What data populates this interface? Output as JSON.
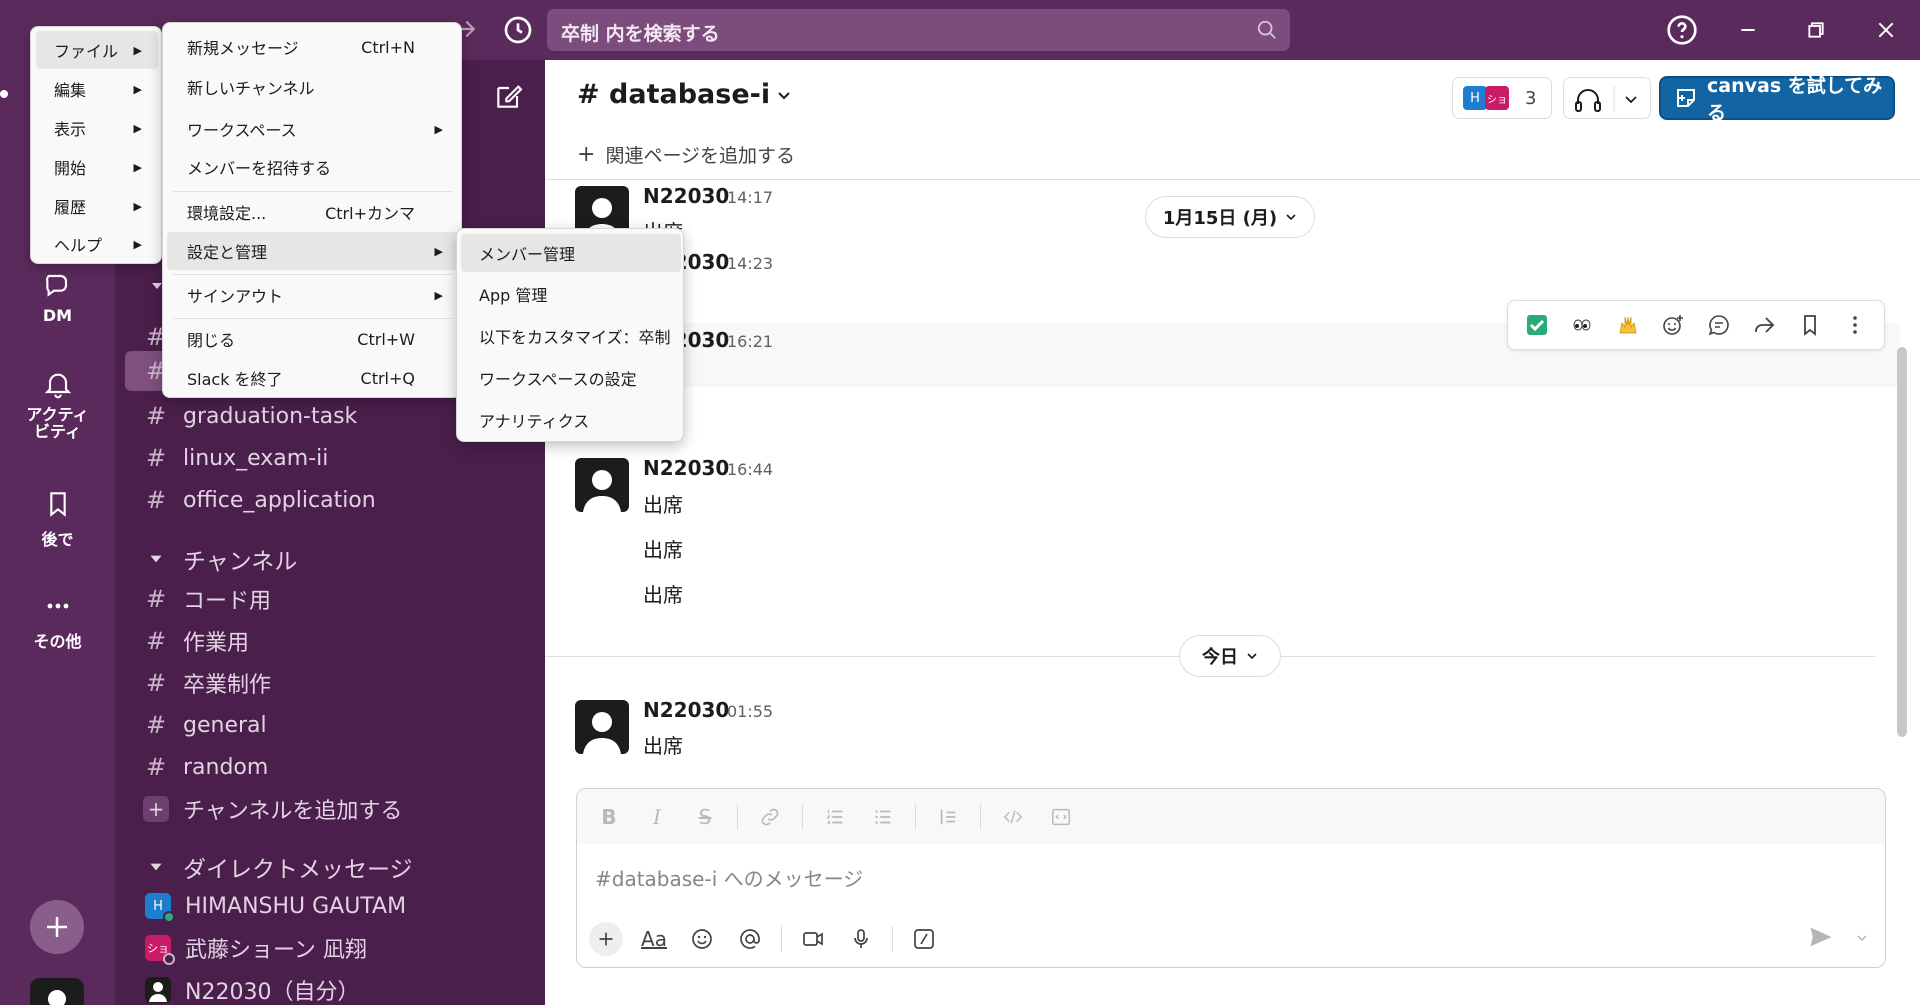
{
  "search": {
    "placeholder": "卒制 内を検索する"
  },
  "rail": {
    "dm_label": "DM",
    "activity_label": "アクティ\nビティ",
    "later_label": "後で",
    "more_label": "その他"
  },
  "sidebar": {
    "channels_partial": [
      {
        "name": "graduation-task"
      },
      {
        "name": "linux_exam-ii"
      },
      {
        "name": "office_application"
      }
    ],
    "channels_section": "チャンネル",
    "channels": [
      {
        "name": "コード用"
      },
      {
        "name": "作業用"
      },
      {
        "name": "卒業制作"
      },
      {
        "name": "general"
      },
      {
        "name": "random"
      }
    ],
    "add_channel": "チャンネルを追加する",
    "dm_section": "ダイレクトメッセージ",
    "dms": [
      {
        "name": "HIMANSHU GAUTAM",
        "initial": "H"
      },
      {
        "name": "武藤ショーン 凪翔",
        "initial": "ショ"
      },
      {
        "name": "N22030（自分）"
      }
    ]
  },
  "channel": {
    "title": "# database-i",
    "members_count": "3",
    "member_initials": [
      "H",
      "ショ"
    ],
    "canvas_button": "canvas を試してみる",
    "bookmark_add": "関連ページを追加する"
  },
  "messages": {
    "date_divider_1": "1月15日 (月)",
    "date_divider_2": "今日",
    "m1": {
      "author": "N22030",
      "time": "14:17",
      "text": "出席"
    },
    "m2": {
      "author": "N22030",
      "time": "14:23"
    },
    "m3": {
      "author": "N22030",
      "time": "16:21"
    },
    "m4": {
      "author": "N22030",
      "time": "16:44",
      "lines": [
        "出席",
        "出席",
        "出席"
      ]
    },
    "m5": {
      "author": "N22030",
      "time": "01:55",
      "text": "出席"
    }
  },
  "composer": {
    "placeholder": "#database-i へのメッセージ"
  },
  "menu_main": {
    "items": [
      "ファイル",
      "編集",
      "表示",
      "開始",
      "履歴",
      "ヘルプ"
    ]
  },
  "menu_file": {
    "new_message": "新規メッセージ",
    "new_message_sc": "Ctrl+N",
    "new_channel": "新しいチャンネル",
    "workspace": "ワークスペース",
    "invite": "メンバーを招待する",
    "preferences": "環境設定...",
    "preferences_sc": "Ctrl+カンマ",
    "settings_admin": "設定と管理",
    "sign_out": "サインアウト",
    "close": "閉じる",
    "close_sc": "Ctrl+W",
    "quit": "Slack を終了",
    "quit_sc": "Ctrl+Q"
  },
  "menu_settings": {
    "items": [
      "メンバー管理",
      "App 管理",
      "以下をカスタマイズ：卒制",
      "ワークスペースの設定",
      "アナリティクス"
    ]
  },
  "colors": {
    "aubergine": "#5b2a5c",
    "sidebar": "#4a1f4b",
    "accent_blue": "#1264a3",
    "presence_green": "#2bac76"
  }
}
